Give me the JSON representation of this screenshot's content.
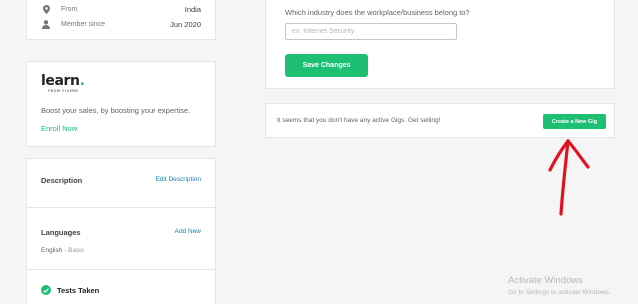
{
  "profile": {
    "rows": [
      {
        "label": "From",
        "value": "India",
        "icon": "location-pin-icon"
      },
      {
        "label": "Member since",
        "value": "Jun 2020",
        "icon": "user-icon"
      }
    ]
  },
  "learn": {
    "logo_word": "learn",
    "logo_dot": ".",
    "logo_sub": "FROM FIVERR",
    "description": "Boost your sales, by boosting your expertise.",
    "enroll_label": "Enroll Now"
  },
  "details": {
    "description_title": "Description",
    "description_link": "Edit Description",
    "languages_title": "Languages",
    "languages_link": "Add New",
    "language_name": "English",
    "language_separator": " - ",
    "language_level": "Basic",
    "tests_title": "Tests Taken"
  },
  "industry": {
    "question": "Which industry does the workplace/business belong to?",
    "input_value": "",
    "input_placeholder": "ex: Internet Security",
    "save_label": "Save Changes"
  },
  "gigs": {
    "message": "It seems that you don't have any active Gigs. Get selling!",
    "create_label": "Create a New Gig"
  },
  "watermark": {
    "title": "Activate Windows",
    "subtitle": "Go to Settings to activate Windows."
  },
  "colors": {
    "accent_green": "#1dbf73",
    "link_blue": "#1a7fb0",
    "annotation_red": "#e0141e",
    "background": "#f5f5f5"
  }
}
